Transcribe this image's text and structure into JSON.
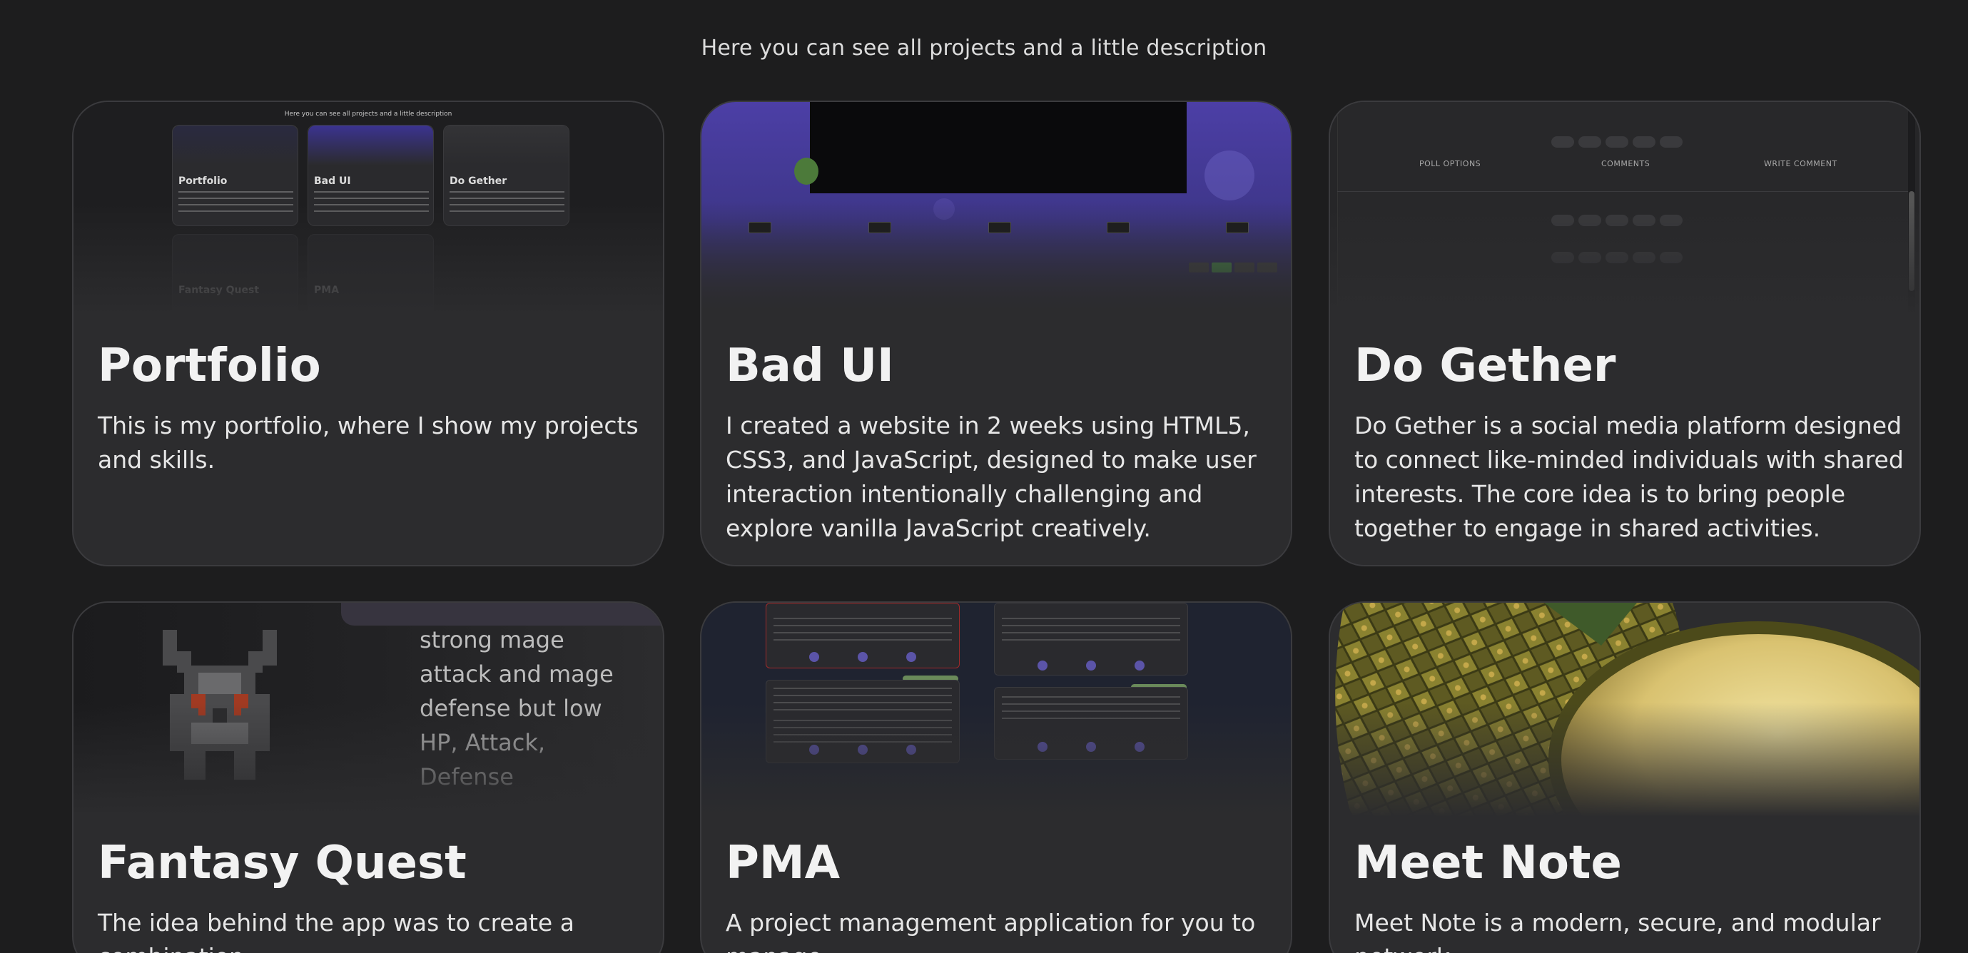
{
  "intro": {
    "text": "Here you can see all projects and a little description"
  },
  "projects": [
    {
      "title": "Portfolio",
      "description": "This is my portfolio, where I show my projects and skills."
    },
    {
      "title": "Bad UI",
      "description": "I created a website in 2 weeks using HTML5, CSS3, and JavaScript, designed to make user interaction intentionally challenging and explore vanilla JavaScript creatively."
    },
    {
      "title": "Do Gether",
      "description": "Do Gether is a social media platform designed to connect like-minded individuals with shared interests. The core idea is to bring people together to engage in shared activities."
    },
    {
      "title": "Fantasy Quest",
      "description": "The idea behind the app was to create a combination"
    },
    {
      "title": "PMA",
      "description": "A project management application for you to manage"
    },
    {
      "title": "Meet Note",
      "description": "Meet Note is a modern, secure, and modular network"
    }
  ],
  "thumbnails": {
    "portfolio": {
      "header": "Here you can see all projects and a little description",
      "mini_cards": [
        "Portfolio",
        "Bad UI",
        "Do Gether",
        "Fantasy Quest",
        "PMA"
      ]
    },
    "do_gether": {
      "tabs": [
        "POLL OPTIONS",
        "COMMENTS",
        "WRITE COMMENT"
      ]
    },
    "fantasy_quest": {
      "text": "strong mage attack and mage defense but low HP, Attack, Defense"
    }
  },
  "colors": {
    "page_background": "#1d1d1e",
    "card_background": "#2c2c2e",
    "card_border": "#3b3b3e",
    "accent_purple": "#4c3fa6"
  }
}
